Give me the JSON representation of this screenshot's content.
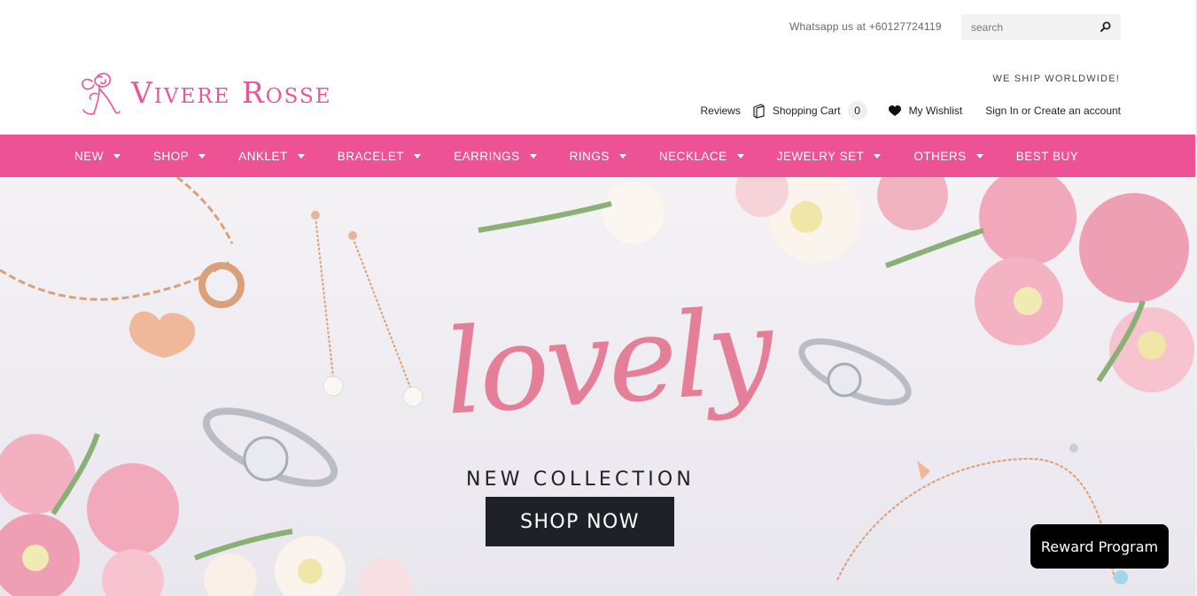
{
  "header": {
    "whatsapp": "Whatsapp us at +60127724119",
    "search_placeholder": "search",
    "logo_text": "Vivere Rosse",
    "ship_note": "WE SHIP WORLDWIDE!",
    "reviews": "Reviews",
    "cart_label": "Shopping Cart",
    "cart_count": "0",
    "wishlist": "My Wishlist",
    "account": "Sign In or Create an account"
  },
  "nav": {
    "items": [
      "NEW",
      "SHOP",
      "ANKLET",
      "BRACELET",
      "EARRINGS",
      "RINGS",
      "NECKLACE",
      "JEWELRY SET",
      "OTHERS",
      "BEST BUY"
    ]
  },
  "hero": {
    "headline": "lovely",
    "subtitle": "NEW COLLECTION",
    "cta": "SHOP NOW"
  },
  "widgets": {
    "reward": "Reward Program"
  },
  "colors": {
    "brand_pink": "#ed5394",
    "logo_pink": "#e8559a",
    "headline_pink": "#e57f97",
    "cta_dark": "#1e2128"
  },
  "icons": [
    "rose-logo-icon",
    "search-icon",
    "cart-icon",
    "heart-icon",
    "caret-down-icon"
  ]
}
